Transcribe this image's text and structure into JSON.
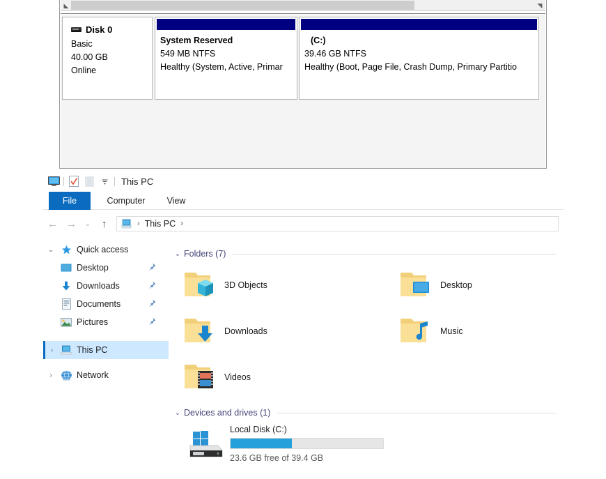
{
  "disk_management": {
    "disk": {
      "icon": "disk-icon",
      "name": "Disk 0",
      "type": "Basic",
      "capacity": "40.00 GB",
      "status": "Online"
    },
    "partitions": [
      {
        "name": "System Reserved",
        "size": "549 MB NTFS",
        "status": "Healthy (System, Active, Primar",
        "bar_color": "#000080"
      },
      {
        "name": "(C:)",
        "size": "39.46 GB NTFS",
        "status": "Healthy (Boot, Page File, Crash Dump, Primary Partitio",
        "bar_color": "#000080"
      }
    ],
    "scrollbar": {
      "left_arrow": "◤",
      "right_arrow": "◢"
    }
  },
  "explorer": {
    "titlebar": {
      "title": "This PC",
      "quick_access": [
        {
          "icon": "this-pc-monitor-icon",
          "name": "this-pc"
        },
        {
          "icon": "properties-icon",
          "name": "properties"
        },
        {
          "icon": "new-folder-icon",
          "name": "new-folder"
        },
        {
          "icon": "chevron-down-icon",
          "name": "customize-quick-access"
        }
      ]
    },
    "ribbon": {
      "tabs": [
        {
          "label": "File",
          "active": true
        },
        {
          "label": "Computer",
          "active": false
        },
        {
          "label": "View",
          "active": false
        }
      ]
    },
    "address_bar": {
      "back": "←",
      "forward": "→",
      "recent": "⌄",
      "up": "↑",
      "icon": "this-pc-icon",
      "crumbs": [
        "This PC"
      ],
      "separator": "›"
    },
    "navigation_pane": {
      "items": [
        {
          "label": "Quick access",
          "icon": "star-icon",
          "chevron": "⌄",
          "level": 0,
          "pinned": false,
          "selected": false
        },
        {
          "label": "Desktop",
          "icon": "desktop-icon",
          "chevron": "",
          "level": 1,
          "pinned": true,
          "selected": false
        },
        {
          "label": "Downloads",
          "icon": "downloads-icon",
          "chevron": "",
          "level": 1,
          "pinned": true,
          "selected": false
        },
        {
          "label": "Documents",
          "icon": "documents-icon",
          "chevron": "",
          "level": 1,
          "pinned": true,
          "selected": false
        },
        {
          "label": "Pictures",
          "icon": "pictures-icon",
          "chevron": "",
          "level": 1,
          "pinned": true,
          "selected": false
        },
        {
          "label": "This PC",
          "icon": "this-pc-icon",
          "chevron": "›",
          "level": 0,
          "pinned": false,
          "selected": true
        },
        {
          "label": "Network",
          "icon": "network-icon",
          "chevron": "›",
          "level": 0,
          "pinned": false,
          "selected": false
        }
      ],
      "pin_glyph": "📌"
    },
    "content": {
      "groups": [
        {
          "title": "Folders (7)",
          "chevron": "⌄",
          "items": [
            {
              "label": "3D Objects",
              "icon": "folder-3d-objects-icon",
              "col": 0,
              "row": 0
            },
            {
              "label": "Desktop",
              "icon": "folder-desktop-icon",
              "col": 1,
              "row": 0
            },
            {
              "label": "Downloads",
              "icon": "folder-downloads-icon",
              "col": 0,
              "row": 1
            },
            {
              "label": "Music",
              "icon": "folder-music-icon",
              "col": 1,
              "row": 1
            },
            {
              "label": "Videos",
              "icon": "folder-videos-icon",
              "col": 0,
              "row": 2
            }
          ]
        },
        {
          "title": "Devices and drives (1)",
          "chevron": "⌄",
          "drives": [
            {
              "label": "Local Disk (C:)",
              "icon": "local-disk-icon",
              "free_text": "23.6 GB free of 39.4 GB",
              "used_percent": 40,
              "bar_fill_color": "#26a0da",
              "bar_track_color": "#e6e6e6"
            }
          ]
        }
      ]
    }
  },
  "colors": {
    "accent": "#0b6cbf",
    "selection": "#cde8ff",
    "group_header": "#44447a",
    "partition_bar": "#000080",
    "drive_bar": "#26a0da"
  }
}
